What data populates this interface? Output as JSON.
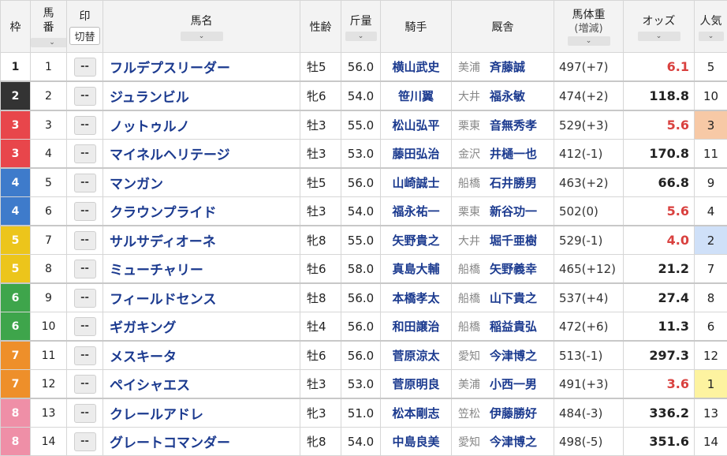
{
  "header": {
    "waku": "枠",
    "umaban_1": "馬",
    "umaban_2": "番",
    "mark": "印",
    "mark_switch": "切替",
    "name": "馬名",
    "sexage": "性齢",
    "kinryo": "斤量",
    "jockey": "騎手",
    "trainer": "厩舎",
    "bw_1": "馬体重",
    "bw_2": "(増減)",
    "odds": "オッズ",
    "pop": "人気"
  },
  "icons": {
    "sort": "sort-chevron-icon"
  },
  "colors": {
    "waku1": "#ffffff",
    "waku2": "#333333",
    "waku3": "#e8464b",
    "waku4": "#3e7bcb",
    "waku5": "#ecc51b",
    "waku6": "#3ea54b",
    "waku7": "#ee8f2a",
    "waku8": "#ef8fa7",
    "pop1": "#fdf3a0",
    "pop2": "#cfe0f8",
    "pop3": "#f7c9a6",
    "hot_odds": "#d9413f"
  },
  "rows": [
    {
      "waku": "1",
      "umaban": "1",
      "mark": "--",
      "name": "フルデプスリーダー",
      "sexage": "牡5",
      "kinryo": "56.0",
      "jockey": "横山武史",
      "area": "美浦",
      "trainer": "斉藤誠",
      "bw": "497(+7)",
      "odds": "6.1",
      "pop": "5"
    },
    {
      "waku": "2",
      "umaban": "2",
      "mark": "--",
      "name": "ジュランビル",
      "sexage": "牝6",
      "kinryo": "54.0",
      "jockey": "笹川翼",
      "area": "大井",
      "trainer": "福永敏",
      "bw": "474(+2)",
      "odds": "118.8",
      "pop": "10"
    },
    {
      "waku": "3",
      "umaban": "3",
      "mark": "--",
      "name": "ノットゥルノ",
      "sexage": "牡3",
      "kinryo": "55.0",
      "jockey": "松山弘平",
      "area": "栗東",
      "trainer": "音無秀孝",
      "bw": "529(+3)",
      "odds": "5.6",
      "pop": "3"
    },
    {
      "waku": "3",
      "umaban": "4",
      "mark": "--",
      "name": "マイネルヘリテージ",
      "sexage": "牡3",
      "kinryo": "53.0",
      "jockey": "藤田弘治",
      "area": "金沢",
      "trainer": "井樋一也",
      "bw": "412(-1)",
      "odds": "170.8",
      "pop": "11"
    },
    {
      "waku": "4",
      "umaban": "5",
      "mark": "--",
      "name": "マンガン",
      "sexage": "牡5",
      "kinryo": "56.0",
      "jockey": "山崎誠士",
      "area": "船橋",
      "trainer": "石井勝男",
      "bw": "463(+2)",
      "odds": "66.8",
      "pop": "9"
    },
    {
      "waku": "4",
      "umaban": "6",
      "mark": "--",
      "name": "クラウンプライド",
      "sexage": "牡3",
      "kinryo": "54.0",
      "jockey": "福永祐一",
      "area": "栗東",
      "trainer": "新谷功一",
      "bw": "502(0)",
      "odds": "5.6",
      "pop": "4"
    },
    {
      "waku": "5",
      "umaban": "7",
      "mark": "--",
      "name": "サルサディオーネ",
      "sexage": "牝8",
      "kinryo": "55.0",
      "jockey": "矢野貴之",
      "area": "大井",
      "trainer": "堀千亜樹",
      "bw": "529(-1)",
      "odds": "4.0",
      "pop": "2"
    },
    {
      "waku": "5",
      "umaban": "8",
      "mark": "--",
      "name": "ミューチャリー",
      "sexage": "牡6",
      "kinryo": "58.0",
      "jockey": "真島大輔",
      "area": "船橋",
      "trainer": "矢野義幸",
      "bw": "465(+12)",
      "odds": "21.2",
      "pop": "7"
    },
    {
      "waku": "6",
      "umaban": "9",
      "mark": "--",
      "name": "フィールドセンス",
      "sexage": "牡8",
      "kinryo": "56.0",
      "jockey": "本橋孝太",
      "area": "船橋",
      "trainer": "山下貴之",
      "bw": "537(+4)",
      "odds": "27.4",
      "pop": "8"
    },
    {
      "waku": "6",
      "umaban": "10",
      "mark": "--",
      "name": "ギガキング",
      "sexage": "牡4",
      "kinryo": "56.0",
      "jockey": "和田譲治",
      "area": "船橋",
      "trainer": "稲益貴弘",
      "bw": "472(+6)",
      "odds": "11.3",
      "pop": "6"
    },
    {
      "waku": "7",
      "umaban": "11",
      "mark": "--",
      "name": "メスキータ",
      "sexage": "牡6",
      "kinryo": "56.0",
      "jockey": "菅原涼太",
      "area": "愛知",
      "trainer": "今津博之",
      "bw": "513(-1)",
      "odds": "297.3",
      "pop": "12"
    },
    {
      "waku": "7",
      "umaban": "12",
      "mark": "--",
      "name": "ペイシャエス",
      "sexage": "牡3",
      "kinryo": "53.0",
      "jockey": "菅原明良",
      "area": "美浦",
      "trainer": "小西一男",
      "bw": "491(+3)",
      "odds": "3.6",
      "pop": "1"
    },
    {
      "waku": "8",
      "umaban": "13",
      "mark": "--",
      "name": "クレールアドレ",
      "sexage": "牝3",
      "kinryo": "51.0",
      "jockey": "松本剛志",
      "area": "笠松",
      "trainer": "伊藤勝好",
      "bw": "484(-3)",
      "odds": "336.2",
      "pop": "13"
    },
    {
      "waku": "8",
      "umaban": "14",
      "mark": "--",
      "name": "グレートコマンダー",
      "sexage": "牝8",
      "kinryo": "54.0",
      "jockey": "中島良美",
      "area": "愛知",
      "trainer": "今津博之",
      "bw": "498(-5)",
      "odds": "351.6",
      "pop": "14"
    }
  ]
}
